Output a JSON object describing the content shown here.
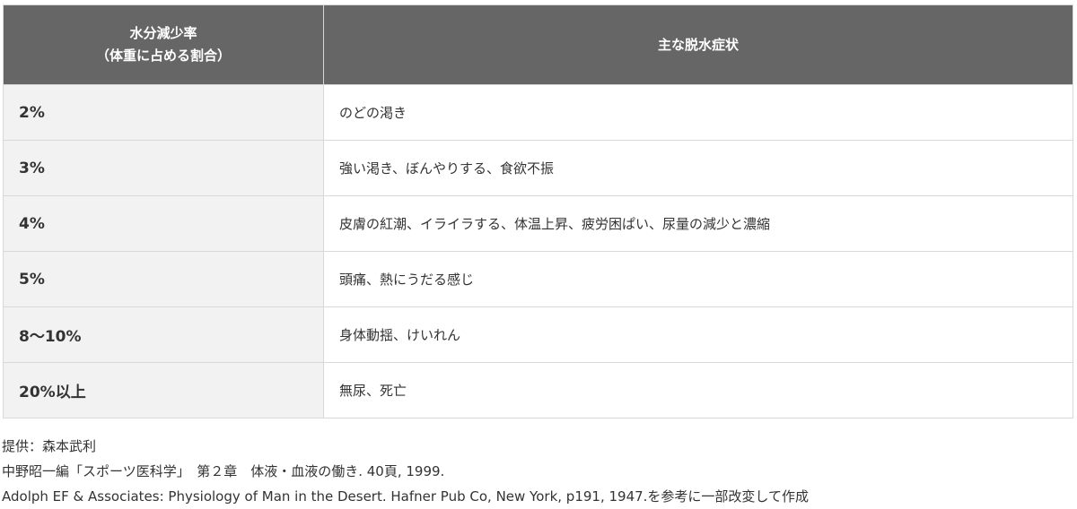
{
  "table": {
    "header": {
      "col1_line1": "水分減少率",
      "col1_line2": "（体重に占める割合）",
      "col2": "主な脱水症状"
    },
    "rows": [
      {
        "rate": "2%",
        "symptoms": "のどの渇き"
      },
      {
        "rate": "3%",
        "symptoms": "強い渇き、ぼんやりする、食欲不振"
      },
      {
        "rate": "4%",
        "symptoms": "皮膚の紅潮、イライラする、体温上昇、疲労困ぱい、尿量の減少と濃縮"
      },
      {
        "rate": "5%",
        "symptoms": "頭痛、熱にうだる感じ"
      },
      {
        "rate": "8〜10%",
        "symptoms": "身体動揺、けいれん"
      },
      {
        "rate": "20%以上",
        "symptoms": "無尿、死亡"
      }
    ]
  },
  "notes": {
    "provider": "提供：森本武利",
    "reference1": "中野昭一編「スポーツ医科学」　第２章　体液・血液の働き. 40頁, 1999.",
    "reference2": "Adolph EF & Associates: Physiology of Man in the Desert. Hafner Pub Co, New York, p191, 1947.を参考に一部改変して作成"
  }
}
